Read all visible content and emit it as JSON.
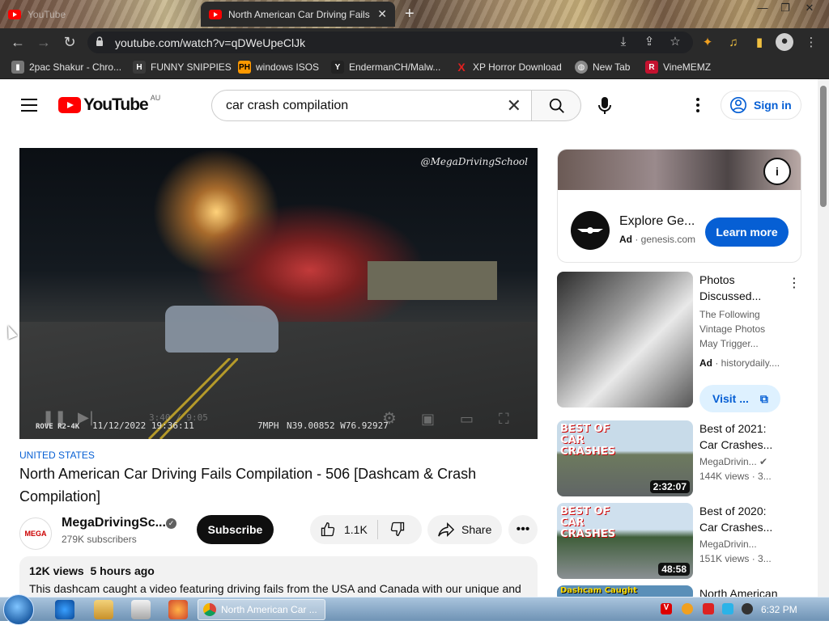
{
  "browser": {
    "tabs": [
      {
        "title": "YouTube",
        "active": false
      },
      {
        "title": "North American Car Driving Fails",
        "active": true
      }
    ],
    "url": "youtube.com/watch?v=qDWeUpeClJk",
    "bookmarks": [
      {
        "label": "2pac Shakur - Chro...",
        "icon": "bookmark-icon",
        "color": "#9a9a9a"
      },
      {
        "label": "FUNNY SNIPPIES",
        "icon": "H",
        "color": "#3a3a3a"
      },
      {
        "label": "windows ISOS",
        "icon": "PH",
        "color": "#ff9900"
      },
      {
        "label": "EndermanCH/Malw...",
        "icon": "Y",
        "color": "#222222"
      },
      {
        "label": "XP Horror Download",
        "icon": "X",
        "color": "#d40000"
      },
      {
        "label": "New Tab",
        "icon": "globe-icon",
        "color": "#6a6a6a"
      },
      {
        "label": "VineMEMZ",
        "icon": "R",
        "color": "#c4122f"
      }
    ]
  },
  "youtube": {
    "logo_text": "YouTube",
    "country": "AU",
    "search_query": "car crash compilation",
    "sign_in": "Sign in",
    "video": {
      "watermark": "@MegaDrivingSchool",
      "hud_brand": "ROVE R2-4K",
      "hud_datetime": "11/12/2022 19:36:11",
      "hud_speed": "7MPH",
      "hud_coords": "N39.00852 W76.92927",
      "time": "3:40 / 9:05"
    },
    "location": "UNITED STATES",
    "title": "North American Car Driving Fails Compilation - 506 [Dashcam & Crash Compilation]",
    "channel": {
      "name": "MegaDrivingSc...",
      "subscribers": "279K subscribers",
      "avatar_text": "MEGA"
    },
    "subscribe": "Subscribe",
    "likes": "1.1K",
    "share": "Share",
    "description": {
      "views": "12K views",
      "age": "5 hours ago",
      "text": "This dashcam caught a video featuring driving fails from the USA and Canada with our unique and"
    },
    "ad": {
      "title": "Explore Ge...",
      "label": "Ad",
      "domain": "genesis.com",
      "cta": "Learn more"
    },
    "sidebar": [
      {
        "title": "Photos Discussed...",
        "channel": "The Following Vintage Photos May Trigger...",
        "meta_label": "Ad",
        "meta": "historydaily....",
        "cta": "Visit ...",
        "is_ad": true
      },
      {
        "title": "Best of 2021: Car Crashes...",
        "channel": "MegaDrivin...",
        "meta": "144K views  ·  3...",
        "duration": "2:32:07",
        "overlay": "BEST OF CAR CRASHES"
      },
      {
        "title": "Best of 2020: Car Crashes...",
        "channel": "MegaDrivin...",
        "meta": "151K views  ·  3...",
        "duration": "48:58",
        "overlay": "BEST OF CAR CRASHES"
      },
      {
        "title": "North American",
        "overlay": "Dashcam Caught"
      }
    ]
  },
  "taskbar": {
    "active_window": "North American Car ...",
    "clock": "6:32 PM"
  }
}
